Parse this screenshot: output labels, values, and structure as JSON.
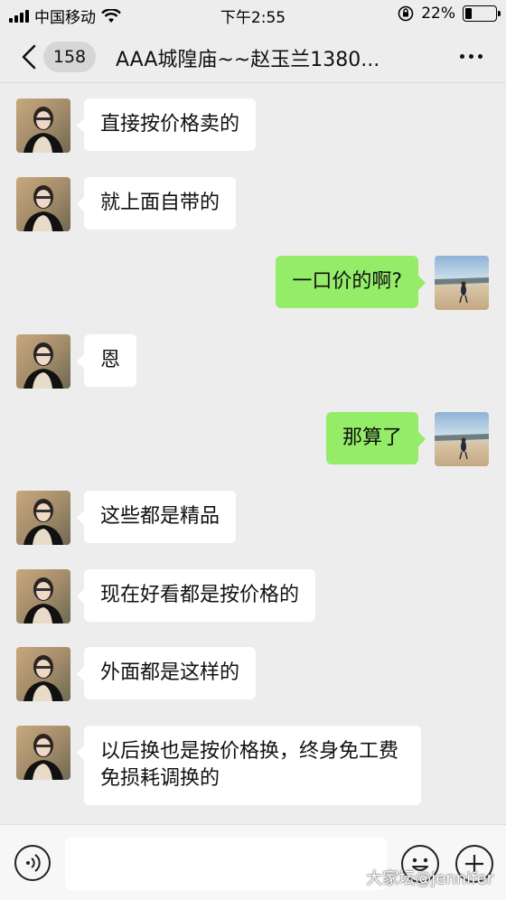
{
  "status_bar": {
    "carrier": "中国移动",
    "time": "下午2:55",
    "battery_percent": "22%",
    "battery_level": 0.22
  },
  "nav": {
    "unread_count": "158",
    "title": "AAA城隍庙~~赵玉兰1380..."
  },
  "messages": [
    {
      "side": "left",
      "text": "直接按价格卖的"
    },
    {
      "side": "left",
      "text": "就上面自带的"
    },
    {
      "side": "right",
      "text": "一口价的啊?"
    },
    {
      "side": "left",
      "text": "恩"
    },
    {
      "side": "right",
      "text": "那算了"
    },
    {
      "side": "left",
      "text": "这些都是精品"
    },
    {
      "side": "left",
      "text": "现在好看都是按价格的"
    },
    {
      "side": "left",
      "text": "外面都是这样的"
    },
    {
      "side": "left",
      "text": "以后换也是按价格换，终身免工费免损耗调换的"
    }
  ],
  "input": {
    "placeholder": ""
  },
  "watermark": "大家坛@jennifer",
  "colors": {
    "background": "#ededed",
    "bubble_self": "#95ec69",
    "bubble_other": "#ffffff"
  }
}
